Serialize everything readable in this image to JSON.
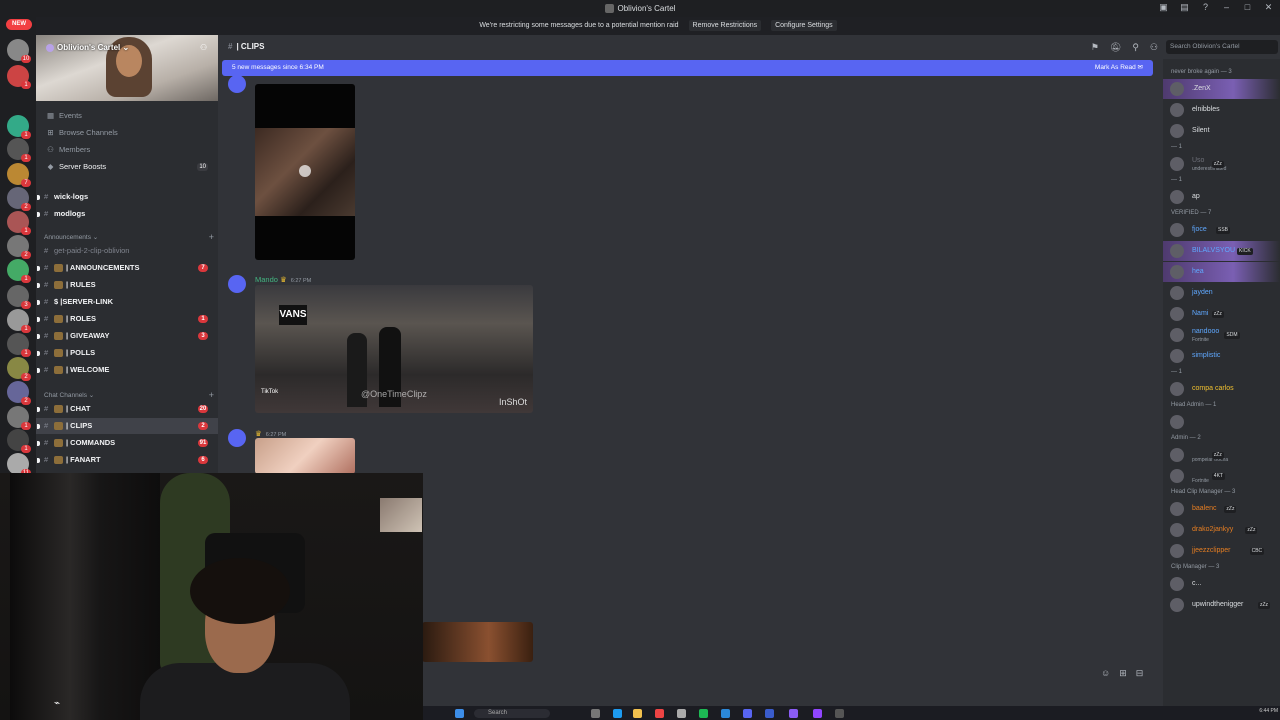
{
  "window": {
    "title": "Oblivion's Cartel"
  },
  "banner": {
    "text": "We're restricting some messages due to a potential mention raid",
    "remove_btn": "Remove Restrictions",
    "configure_btn": "Configure Settings"
  },
  "guilds": {
    "new_label": "NEW",
    "badges": [
      "10",
      "1",
      "1",
      "1",
      "7",
      "2",
      "1",
      "2",
      "1",
      "3",
      "1",
      "1",
      "2",
      "2",
      "1",
      "1",
      "11"
    ]
  },
  "sidebar": {
    "server_name": "Oblivion's Cartel",
    "nav": [
      {
        "label": "Events",
        "count": ""
      },
      {
        "label": "Browse Channels",
        "count": ""
      },
      {
        "label": "Members",
        "count": ""
      },
      {
        "label": "Server Boosts",
        "count": "10"
      }
    ],
    "channels_top": [
      "wick-logs",
      "modlogs"
    ],
    "announcements_label": "Announcements",
    "announcement_channels": [
      {
        "name": "get-paid-2-clip-oblivion",
        "unread": ""
      },
      {
        "name": "| ANNOUNCEMENTS",
        "unread": "7"
      },
      {
        "name": "| RULES",
        "unread": ""
      },
      {
        "name": "$ |SERVER-LINK",
        "unread": ""
      },
      {
        "name": "| ROLES",
        "unread": "1"
      },
      {
        "name": "| GIVEAWAY",
        "unread": "3"
      },
      {
        "name": "| POLLS",
        "unread": ""
      },
      {
        "name": "| WELCOME",
        "unread": ""
      }
    ],
    "chat_label": "Chat Channels",
    "chat_channels": [
      {
        "name": "| CHAT",
        "unread": "20"
      },
      {
        "name": "| CLIPS",
        "unread": "2"
      },
      {
        "name": "| COMMANDS",
        "unread": "91"
      },
      {
        "name": "| FANART",
        "unread": "6"
      }
    ]
  },
  "header": {
    "channel": "| CLIPS",
    "search_placeholder": "Search Oblivion's Cartel"
  },
  "chat": {
    "new_messages": "5 new messages since 6:34 PM",
    "mark_read": "Mark As Read",
    "messages": [
      {
        "author": "",
        "time": "6:27 PM"
      },
      {
        "author": "Mando",
        "time": "6:27 PM",
        "watermark": "@OneTimeClipz",
        "store": "VANS",
        "source": "TikTok",
        "editor": "InShOt"
      },
      {
        "author": "",
        "time": "6:27 PM"
      }
    ]
  },
  "members": [
    {
      "type": "cat",
      "label": "never broke again — 3"
    },
    {
      "type": "mem",
      "name": ".ZenX",
      "sub": "",
      "tag": "",
      "color": "#dbdee1",
      "hl": true
    },
    {
      "type": "mem",
      "name": "elnibbles",
      "sub": "",
      "tag": "",
      "color": "#dbdee1"
    },
    {
      "type": "mem",
      "name": "Silent",
      "sub": "",
      "tag": "",
      "color": "#dbdee1"
    },
    {
      "type": "cat",
      "label": "— 1"
    },
    {
      "type": "mem",
      "name": "Uso",
      "sub": "underestimated",
      "tag": "zZz",
      "color": "#6d6f78"
    },
    {
      "type": "cat",
      "label": "— 1"
    },
    {
      "type": "mem",
      "name": "ap",
      "sub": "",
      "tag": "",
      "color": "#dbdee1"
    },
    {
      "type": "cat",
      "label": "VERIFIED — 7"
    },
    {
      "type": "mem",
      "name": "fjoce",
      "sub": "",
      "tag": "SSB",
      "color": "#5fa8ff"
    },
    {
      "type": "mem",
      "name": "BILALVSYOU",
      "sub": "",
      "tag": "KICK",
      "color": "#5fa8ff",
      "hl": true
    },
    {
      "type": "mem",
      "name": "hea",
      "sub": "",
      "tag": "",
      "color": "#5fa8ff",
      "hl": true
    },
    {
      "type": "mem",
      "name": "jayden",
      "sub": "",
      "tag": "",
      "color": "#5fa8ff"
    },
    {
      "type": "mem",
      "name": "Nami",
      "sub": "",
      "tag": "zZz",
      "color": "#5fa8ff"
    },
    {
      "type": "mem",
      "name": "nandooo",
      "sub": "Fortnite",
      "tag": "SDM",
      "color": "#5fa8ff"
    },
    {
      "type": "mem",
      "name": "simplistic",
      "sub": "",
      "tag": "",
      "color": "#5fa8ff"
    },
    {
      "type": "cat",
      "label": "— 1"
    },
    {
      "type": "mem",
      "name": "compa carlos",
      "sub": "",
      "tag": "",
      "color": "#f0c030"
    },
    {
      "type": "cat",
      "label": "Head Admin — 1"
    },
    {
      "type": "mem",
      "name": "",
      "sub": "",
      "tag": "",
      "color": "#dbdee1"
    },
    {
      "type": "cat",
      "label": "Admin — 2"
    },
    {
      "type": "mem",
      "name": "",
      "sub": "pompeiar trocha",
      "tag": "zZz",
      "color": "#a25de0"
    },
    {
      "type": "mem",
      "name": "",
      "sub": "Fortnite",
      "tag": "4KT",
      "color": "#a25de0"
    },
    {
      "type": "cat",
      "label": "Head Clip Manager — 3"
    },
    {
      "type": "mem",
      "name": "baalenc",
      "sub": "",
      "tag": "zZz",
      "color": "#e67e22"
    },
    {
      "type": "mem",
      "name": "drako2jankyy",
      "sub": "",
      "tag": "zZz",
      "color": "#e67e22"
    },
    {
      "type": "mem",
      "name": "jjeezzclipper",
      "sub": "",
      "tag": "CBC",
      "color": "#e67e22"
    },
    {
      "type": "cat",
      "label": "Clip Manager — 3"
    },
    {
      "type": "mem",
      "name": "c...",
      "sub": "",
      "tag": "",
      "color": "#dbdee1"
    },
    {
      "type": "mem",
      "name": "upwindthenigger",
      "sub": "",
      "tag": "zZz",
      "color": "#dbdee1"
    }
  ],
  "taskbar": {
    "search": "Search",
    "time": "6:44 PM"
  },
  "colors": {
    "accent": "#5865f2",
    "bg": "#313338",
    "sidebar": "#2b2d31",
    "danger": "#da373c"
  }
}
